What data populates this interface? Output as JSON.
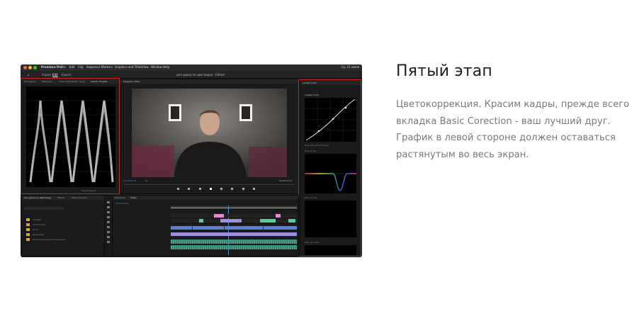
{
  "step": {
    "title": "Пятый этап",
    "description": "Цветокоррекция. Красим кадры, прежде всего вкладка Basic Corection - ваш лучший друг. График в левой стороне должен оставаться растянутым во весь экран."
  },
  "premiere": {
    "app_name": "Premiere Pro",
    "menu": [
      "File",
      "Edit",
      "Clip",
      "Sequence",
      "Markers",
      "Graphics and Titles",
      "View",
      "Window",
      "Help"
    ],
    "workspace_tabs": [
      "Import",
      "Edit",
      "Export"
    ],
    "status_right": "Ср, 11 июня",
    "document_title": "для урока по цветкоррe - Edited",
    "scopes_tabs": [
      "Программ",
      "Metadata",
      "Audio Track Mixer: Video",
      "Lumetri Scopes"
    ],
    "program_tab": "Program: Video",
    "timecode_left": "00:02:09:16",
    "fit": "Fit",
    "timecode_right": "00:00:14:11",
    "lumetri_tab": "Lumetri Color",
    "lumetri_section": "Lumetri Color",
    "curves": [
      "Hue Saturation Curves",
      "Hue vs Sat",
      "Hue vs Hue",
      "Hue vs Luma"
    ],
    "project_tabs": [
      "для урока по цветокору",
      "Effects",
      "Media Browser"
    ],
    "bins": [
      "Footage",
      "Sound Video",
      "Track",
      "Видеоряд",
      "Дополнительные материалы"
    ],
    "timeline_tabs": [
      "Reference",
      "Video"
    ],
    "timeline_timecode": "00:02:09:16",
    "clamp_label": "Clamp Signal"
  },
  "colors": {
    "highlight": "#d21e26",
    "clip_violet": "#9c8fe0",
    "clip_green": "#4fd39a",
    "clip_pink": "#e08ad8",
    "clip_blue": "#5b7fd8"
  }
}
